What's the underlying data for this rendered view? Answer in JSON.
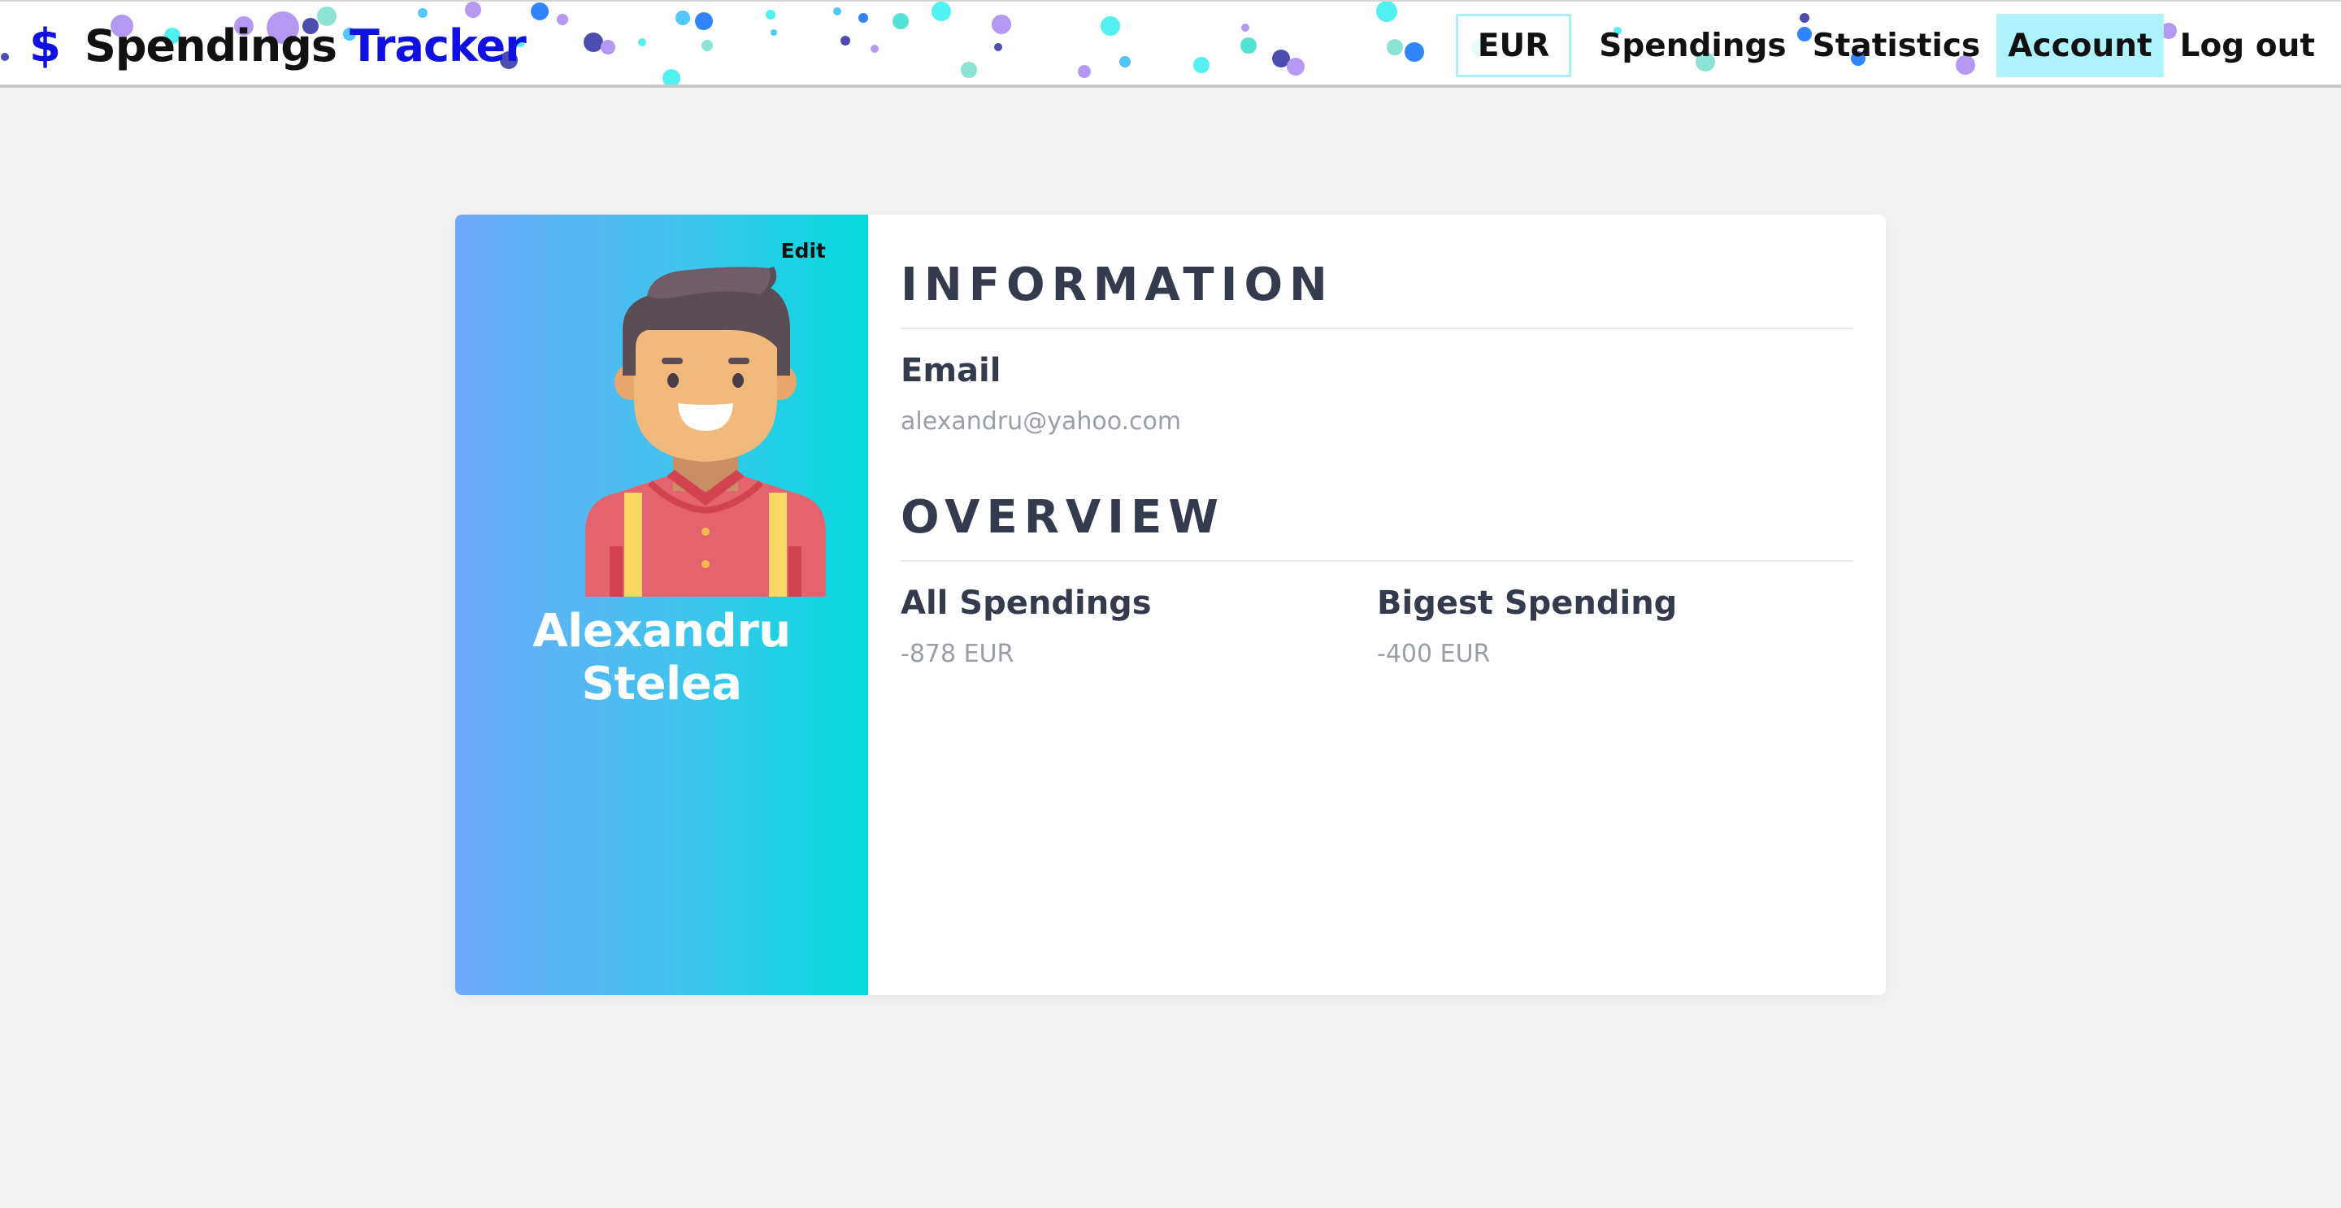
{
  "app": {
    "brand_icon": "dollar-icon",
    "brand_symbol": "$",
    "brand_main": "Spendings",
    "brand_accent": "Tracker",
    "accent_color": "#1010e0"
  },
  "nav": {
    "currency": "EUR",
    "items": [
      "Spendings",
      "Statistics",
      "Account",
      "Log out"
    ],
    "active": "Account",
    "active_color": "#aef3fb"
  },
  "profile": {
    "edit_label": "Edit",
    "name": "Alexandru Stelea",
    "avatar_icon": "man-avatar-icon",
    "gradient": [
      "#6fa8fa",
      "#05dbde"
    ]
  },
  "information": {
    "title": "INFORMATION",
    "email_label": "Email",
    "email_value": "alexandru@yahoo.com"
  },
  "overview": {
    "title": "OVERVIEW",
    "all_label": "All Spendings",
    "all_value": "-878 EUR",
    "biggest_label": "Bigest Spending",
    "biggest_value": "-400 EUR"
  }
}
